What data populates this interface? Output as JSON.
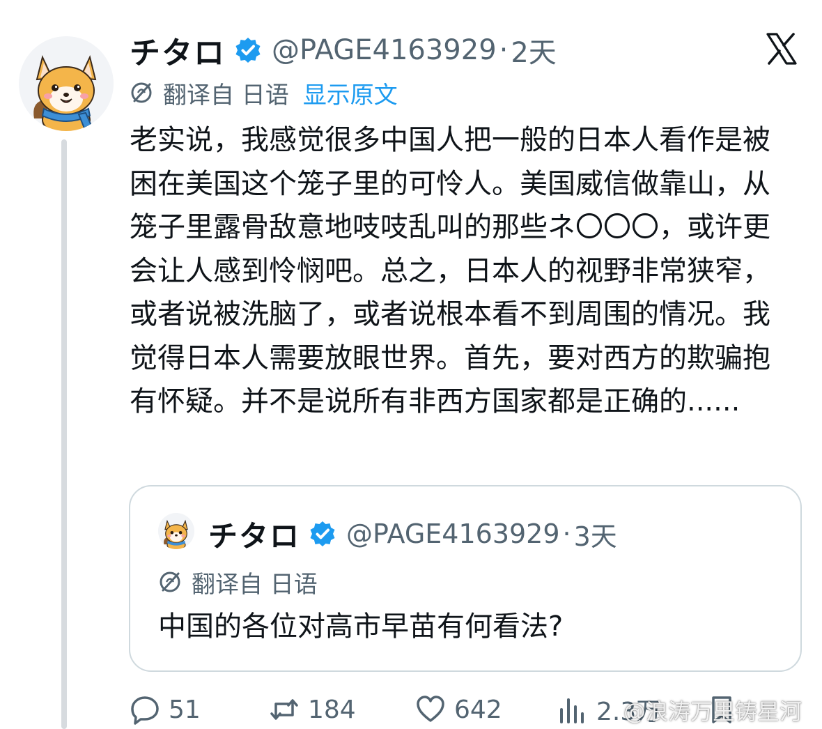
{
  "post": {
    "author": {
      "display_name": "チタロ",
      "handle": "@PAGE4163929",
      "verified": true,
      "avatar_icon": "shiba-dog-avatar-icon"
    },
    "separator": "·",
    "time": "2天",
    "platform_logo": "x-logo-icon",
    "translation": {
      "label": "翻译自 日语",
      "show_original": "显示原文"
    },
    "text": "老实说，我感觉很多中国人把一般的日本人看作是被困在美国这个笼子里的可怜人。美国威信做靠山，从笼子里露骨敌意地吱吱乱叫的那些ネ〇〇〇，或许更会让人感到怜悯吧。总之，日本人的视野非常狭窄，或者说被洗脑了，或者说根本看不到周围的情况。我觉得日本人需要放眼世界。首先，要对西方的欺骗抱有怀疑。并不是说所有非西方国家都是正确的......"
  },
  "quoted_post": {
    "author": {
      "display_name": "チタロ",
      "handle": "@PAGE4163929",
      "verified": true
    },
    "separator": "·",
    "time": "3天",
    "translation": {
      "label": "翻译自 日语"
    },
    "text": "中国的各位对高市早苗有何看法?"
  },
  "actions": {
    "replies": "51",
    "reposts": "184",
    "likes": "642",
    "views": "2.3万"
  },
  "watermark": "@浪涛万里铸星河",
  "colors": {
    "text": "#0f1419",
    "secondary": "#536471",
    "link": "#1d9bf0",
    "verified": "#1d9bf0",
    "border": "#cfd9de"
  }
}
